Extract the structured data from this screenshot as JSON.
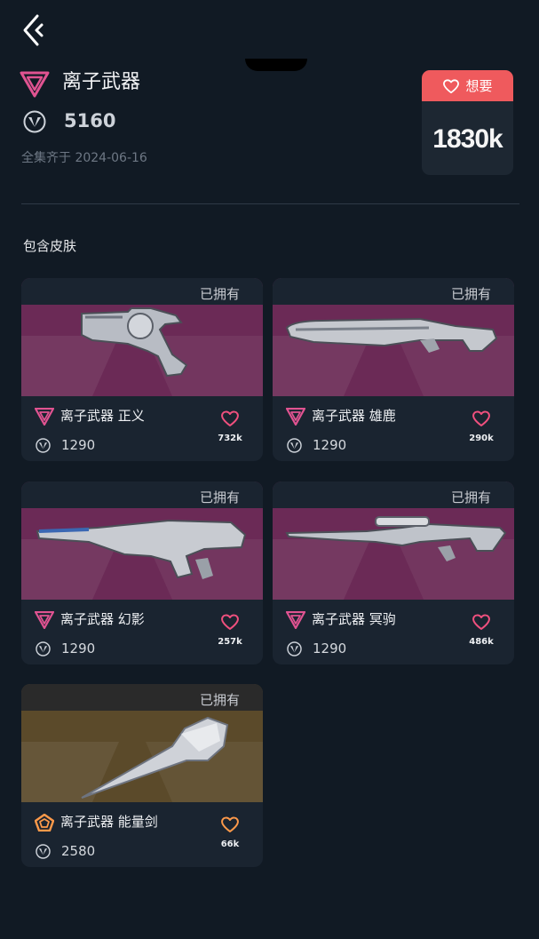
{
  "bundle": {
    "title": "离子武器",
    "price": "5160",
    "complete_date": "全集齐于 2024-06-16",
    "tier_icon": "prism-triangle-icon",
    "currency_icon": "valorant-points-icon"
  },
  "want": {
    "label": "想要",
    "count": "1830k",
    "icon": "heart-outline-icon"
  },
  "section_title": "包含皮肤",
  "colors": {
    "background": "#111a24",
    "card": "#1a2430",
    "want_accent": "#ef5a5d",
    "premium_art": "#6b2a56",
    "exclusive_art": "#5b4a2a",
    "premium_heart": "#f0507e",
    "exclusive_heart": "#ff9a4a"
  },
  "skins": [
    {
      "owned": "已拥有",
      "name": "离子武器 正义",
      "price": "1290",
      "likes": "732k",
      "tier": "premium",
      "weapon": "sheriff"
    },
    {
      "owned": "已拥有",
      "name": "离子武器 雄鹿",
      "price": "1290",
      "likes": "290k",
      "tier": "premium",
      "weapon": "bucky"
    },
    {
      "owned": "已拥有",
      "name": "离子武器 幻影",
      "price": "1290",
      "likes": "257k",
      "tier": "premium",
      "weapon": "phantom"
    },
    {
      "owned": "已拥有",
      "name": "离子武器 冥驹",
      "price": "1290",
      "likes": "486k",
      "tier": "premium",
      "weapon": "operator"
    },
    {
      "owned": "已拥有",
      "name": "离子武器 能量剑",
      "price": "2580",
      "likes": "66k",
      "tier": "exclusive",
      "weapon": "melee"
    }
  ]
}
